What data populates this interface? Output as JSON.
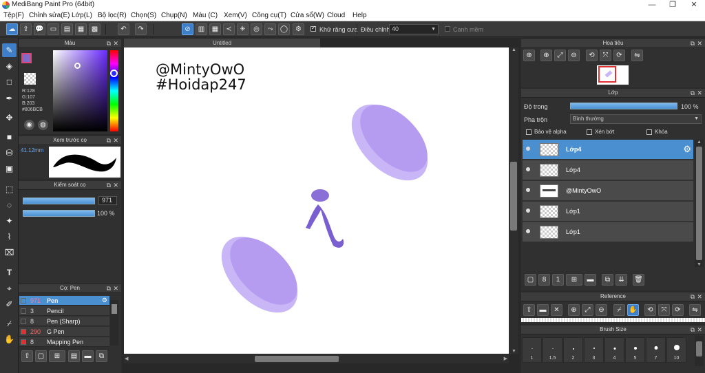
{
  "window": {
    "title": "MediBang Paint Pro (64bit)",
    "min": "—",
    "max": "❐",
    "close": "✕"
  },
  "menu": [
    "Tệp(F)",
    "Chỉnh sửa(E)",
    "Lớp(L)",
    "Bộ lọc(R)",
    "Chọn(S)",
    "Chụp(N)",
    "Màu (C)",
    "Xem(V)",
    "Công cụ(T)",
    "Cửa sổ(W)",
    "Cloud",
    "Help"
  ],
  "toolbar": {
    "antialias_label": "Khử răng cưa",
    "correction_label": "Điều chỉnh",
    "correction_value": "40",
    "smooth_label": "Canh mềm"
  },
  "color_panel": {
    "title": "Màu",
    "r": "R:128",
    "g": "G:107",
    "b": "B:203",
    "hex": "#806BCB",
    "fg_color": "#806BCB"
  },
  "brush_preview": {
    "title": "Xem trước cọ",
    "size": "41.12mm"
  },
  "brush_control": {
    "title": "Kiểm soát cọ",
    "size_value": "971",
    "opacity_value": "100 %",
    "size_fraction": 1.0,
    "opacity_fraction": 1.0
  },
  "brush_list": {
    "title": "Cọ: Pen",
    "items": [
      {
        "size": "971",
        "name": "Pen",
        "color": "#3a3a3a",
        "selected": true
      },
      {
        "size": "3",
        "name": "Pencil",
        "color": "#3a3a3a",
        "selected": false
      },
      {
        "size": "8",
        "name": "Pen (Sharp)",
        "color": "#3a3a3a",
        "selected": false
      },
      {
        "size": "290",
        "name": "G Pen",
        "color": "#e03030",
        "selected": false
      },
      {
        "size": "8",
        "name": "Mapping Pen",
        "color": "#e03030",
        "selected": false
      }
    ]
  },
  "document": {
    "tab_title": "Untitled",
    "text_line1": "@MintyOwO",
    "text_line2": "#Hoidap247"
  },
  "navigator": {
    "title": "Hoa tiêu"
  },
  "layer_panel": {
    "title": "Lớp",
    "opacity_label": "Độ trong",
    "opacity_value": "100 %",
    "opacity_fraction": 1.0,
    "blend_label": "Pha trộn",
    "blend_value": "Bình thường",
    "protect_alpha": "Bảo vệ alpha",
    "clipping": "Xén bớt",
    "lock": "Khóa",
    "layers": [
      {
        "name": "Lớp4",
        "selected": true
      },
      {
        "name": "Lớp4",
        "selected": false
      },
      {
        "name": "@MintyOwO",
        "selected": false
      },
      {
        "name": "Lớp1",
        "selected": false
      },
      {
        "name": "Lớp1",
        "selected": false
      }
    ]
  },
  "reference": {
    "title": "Reference"
  },
  "brush_size": {
    "title": "Brush Size",
    "sizes": [
      "1",
      "1.5",
      "2",
      "3",
      "4",
      "5",
      "7",
      "10"
    ]
  }
}
